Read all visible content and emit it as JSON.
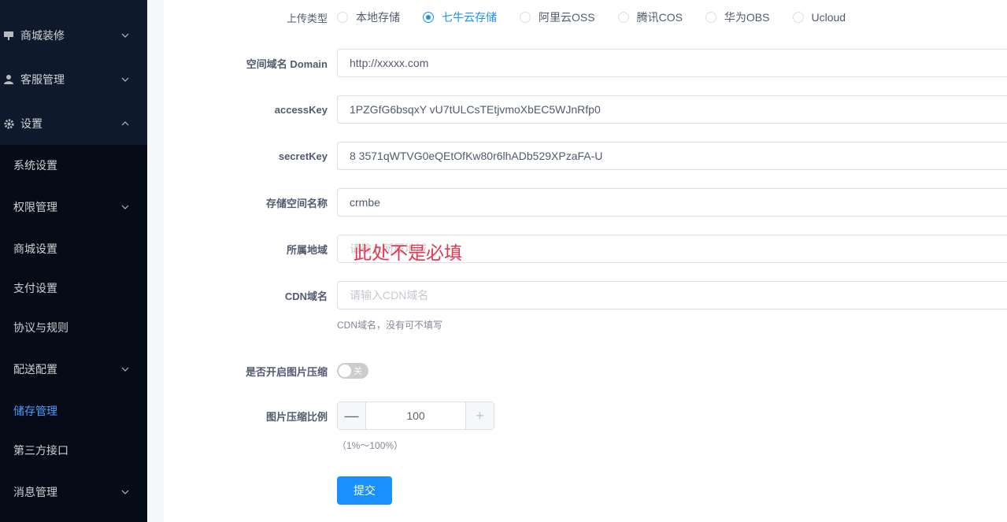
{
  "sidebar": {
    "groups": [
      {
        "label": "商城装修",
        "icon": "store-decor-icon",
        "expanded": false
      },
      {
        "label": "客服管理",
        "icon": "user-icon",
        "expanded": false
      },
      {
        "label": "设置",
        "icon": "gear-icon",
        "expanded": true
      }
    ],
    "sub_items": [
      {
        "label": "系统设置",
        "has_children": false
      },
      {
        "label": "权限管理",
        "has_children": true
      },
      {
        "label": "商城设置",
        "has_children": false
      },
      {
        "label": "支付设置",
        "has_children": false
      },
      {
        "label": "协议与规则",
        "has_children": false
      },
      {
        "label": "配送配置",
        "has_children": true
      },
      {
        "label": "储存管理",
        "has_children": false,
        "active": true
      },
      {
        "label": "第三方接口",
        "has_children": false
      },
      {
        "label": "消息管理",
        "has_children": true
      }
    ]
  },
  "form": {
    "upload_type": {
      "label": "上传类型",
      "options": [
        "本地存储",
        "七牛云存储",
        "阿里云OSS",
        "腾讯COS",
        "华为OBS",
        "Ucloud"
      ],
      "selected": "七牛云存储"
    },
    "domain": {
      "label": "空间域名 Domain",
      "value": "http://xxxxx.com"
    },
    "access_key": {
      "label": "accessKey",
      "value": "1PZGfG6bsqxY vU7tULCsTEtjvmoXbEC5WJnRfp0"
    },
    "secret_key": {
      "label": "secretKey",
      "value": "8 3571qWTVG0eQEtOfKw80r6lhADb529XPzaFA-U"
    },
    "bucket": {
      "label": "存储空间名称",
      "value": "crmbe"
    },
    "region": {
      "label": "所属地域",
      "placeholder": "请输入所属地域"
    },
    "region_annotation": "此处不是必填",
    "cdn": {
      "label": "CDN域名",
      "placeholder": "请输入CDN域名",
      "hint": "CDN域名，没有可不填写"
    },
    "compress": {
      "label": "是否开启图片压缩",
      "state_text": "关",
      "on": false
    },
    "ratio": {
      "label": "图片压缩比例",
      "value": "100",
      "minus": "—",
      "plus": "+",
      "hint": "（1%～100%）"
    },
    "submit_label": "提交"
  },
  "colors": {
    "sidebar_bg": "#0e1a2b",
    "sidebar_sub_bg": "#050c17",
    "accent": "#1890ff",
    "annotation": "#e8364f"
  }
}
